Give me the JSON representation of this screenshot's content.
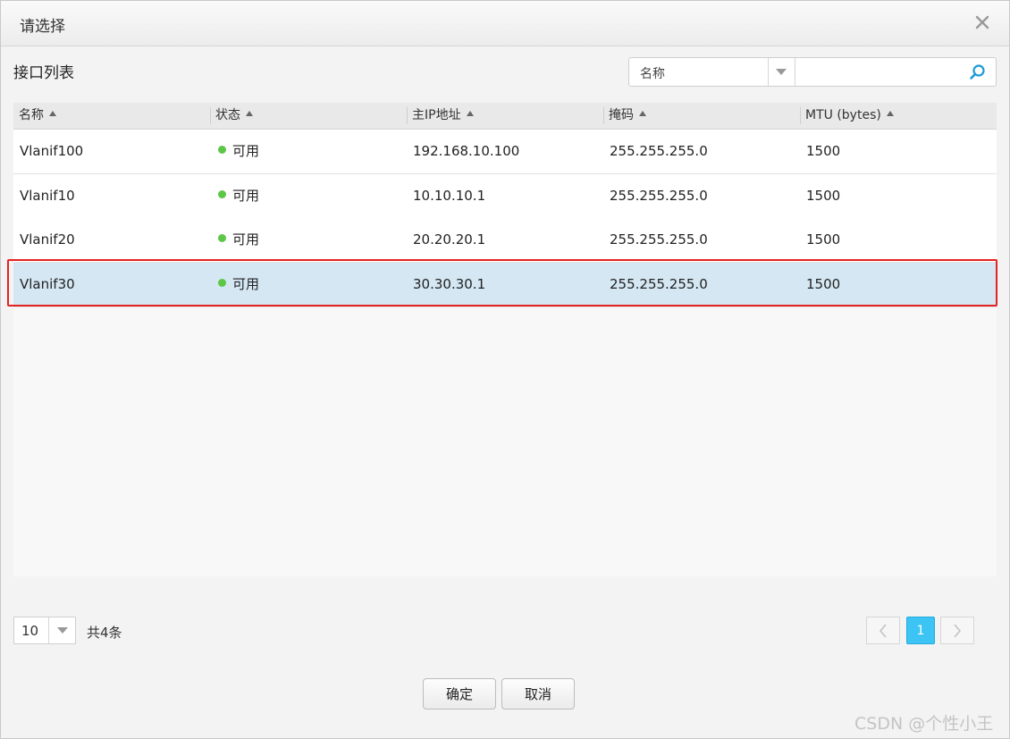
{
  "dialog": {
    "title": "请选择"
  },
  "section_title": "接口列表",
  "search": {
    "field_selected": "名称",
    "input_value": "",
    "input_placeholder": ""
  },
  "table": {
    "columns": [
      "名称",
      "状态",
      "主IP地址",
      "掩码",
      "MTU (bytes)"
    ],
    "rows": [
      {
        "name": "Vlanif100",
        "status": "可用",
        "ip": "192.168.10.100",
        "mask": "255.255.255.0",
        "mtu": "1500"
      },
      {
        "name": "Vlanif10",
        "status": "可用",
        "ip": "10.10.10.1",
        "mask": "255.255.255.0",
        "mtu": "1500"
      },
      {
        "name": "Vlanif20",
        "status": "可用",
        "ip": "20.20.20.1",
        "mask": "255.255.255.0",
        "mtu": "1500"
      },
      {
        "name": "Vlanif30",
        "status": "可用",
        "ip": "30.30.30.1",
        "mask": "255.255.255.0",
        "mtu": "1500"
      }
    ],
    "selected_row": 3
  },
  "pagination": {
    "page_size": "10",
    "total": "共4条",
    "current_page": "1"
  },
  "buttons": {
    "ok": "确定",
    "cancel": "取消"
  },
  "watermark": "CSDN @个性小王",
  "colors": {
    "status_ok": "#5cc647",
    "selected_row": "#d4e7f3",
    "highlight": "#e52222",
    "page_active": "#3cc4f4"
  }
}
